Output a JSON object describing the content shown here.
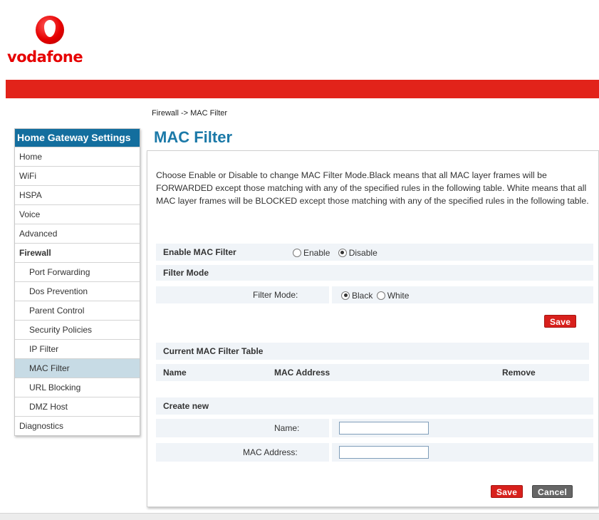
{
  "brand": {
    "logo_text": "vodafone",
    "accent": "#e2231a",
    "blue": "#1b79a8"
  },
  "breadcrumb": "Firewall -> MAC Filter",
  "sidebar": {
    "title": "Home Gateway Settings",
    "items": [
      {
        "label": "Home"
      },
      {
        "label": "WiFi"
      },
      {
        "label": "HSPA"
      },
      {
        "label": "Voice"
      },
      {
        "label": "Advanced"
      },
      {
        "label": "Firewall"
      },
      {
        "label": "Port Forwarding"
      },
      {
        "label": "Dos Prevention"
      },
      {
        "label": "Parent Control"
      },
      {
        "label": "Security Policies"
      },
      {
        "label": "IP Filter"
      },
      {
        "label": "MAC Filter"
      },
      {
        "label": "URL Blocking"
      },
      {
        "label": "DMZ Host"
      },
      {
        "label": "Diagnostics"
      }
    ],
    "active": "MAC Filter"
  },
  "main": {
    "title": "MAC Filter",
    "description": "Choose Enable or Disable to change MAC Filter Mode.Black means that all MAC layer frames will be FORWARDED except those matching with any of the specified rules in the following table. White means that all MAC layer frames will be BLOCKED except those matching with any of the specified rules in the following table.",
    "enable_filter": {
      "label": "Enable MAC Filter",
      "options": [
        "Enable",
        "Disable"
      ],
      "selected": "Disable"
    },
    "filter_mode_section": "Filter Mode",
    "filter_mode": {
      "label": "Filter Mode:",
      "options": [
        "Black",
        "White"
      ],
      "selected": "Black"
    },
    "save_label": "Save",
    "table": {
      "title": "Current MAC Filter Table",
      "columns": [
        "Name",
        "MAC Address",
        "Remove"
      ]
    },
    "create_new": {
      "title": "Create new",
      "name_label": "Name:",
      "name_value": "",
      "mac_label": "MAC Address:",
      "mac_value": ""
    },
    "save_bottom_label": "Save",
    "cancel_label": "Cancel"
  }
}
